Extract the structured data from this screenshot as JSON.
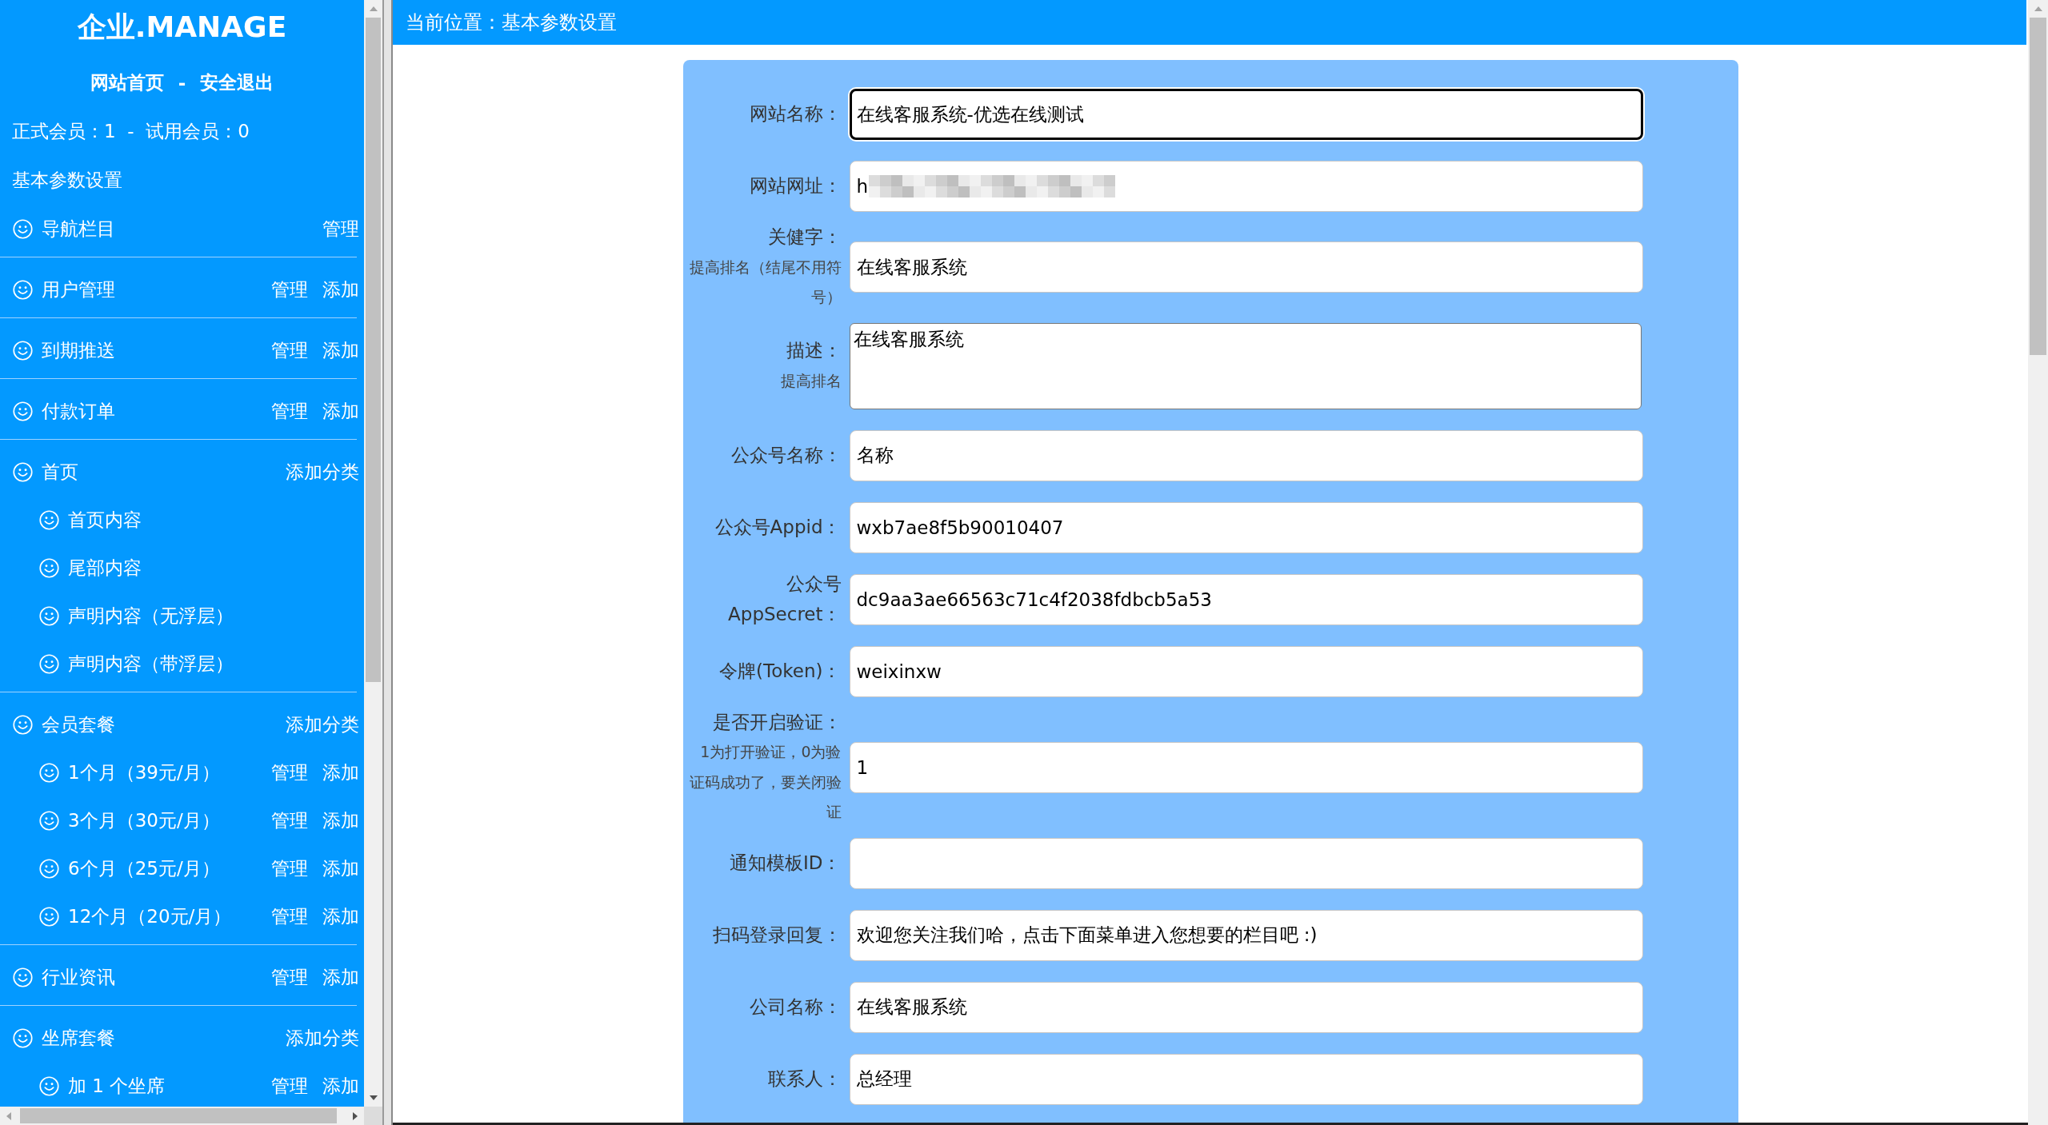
{
  "sidebar": {
    "logo": "企业.MANAGE",
    "top_links": [
      {
        "label": "网站首页"
      },
      {
        "label": "安全退出"
      }
    ],
    "link_separator": "-",
    "member_stats": "正式会员：1  -  试用会员：0",
    "settings_link": "基本参数设置",
    "groups": [
      {
        "label": "导航栏目",
        "actions": [
          "管理"
        ]
      },
      {
        "label": "用户管理",
        "actions": [
          "管理",
          "添加"
        ]
      },
      {
        "label": "到期推送",
        "actions": [
          "管理",
          "添加"
        ]
      },
      {
        "label": "付款订单",
        "actions": [
          "管理",
          "添加"
        ]
      },
      {
        "label": "首页",
        "actions": [
          "添加分类"
        ],
        "children": [
          {
            "label": "首页内容"
          },
          {
            "label": "尾部内容"
          },
          {
            "label": "声明内容（无浮层）"
          },
          {
            "label": "声明内容（带浮层）"
          }
        ]
      },
      {
        "label": "会员套餐",
        "actions": [
          "添加分类"
        ],
        "children": [
          {
            "label": "1个月（39元/月）",
            "actions": [
              "管理",
              "添加"
            ]
          },
          {
            "label": "3个月（30元/月）",
            "actions": [
              "管理",
              "添加"
            ]
          },
          {
            "label": "6个月（25元/月）",
            "actions": [
              "管理",
              "添加"
            ]
          },
          {
            "label": "12个月（20元/月）",
            "actions": [
              "管理",
              "添加"
            ]
          }
        ]
      },
      {
        "label": "行业资讯",
        "actions": [
          "管理",
          "添加"
        ]
      },
      {
        "label": "坐席套餐",
        "actions": [
          "添加分类"
        ],
        "children": [
          {
            "label": "加 1 个坐席",
            "actions": [
              "管理",
              "添加"
            ]
          }
        ]
      }
    ]
  },
  "breadcrumb": "当前位置：基本参数设置",
  "form": {
    "fields": [
      {
        "label": "网站名称：",
        "kind": "input",
        "value": "在线客服系统-优选在线测试",
        "focused": true,
        "redacted": false
      },
      {
        "label": "网站网址：",
        "kind": "input",
        "value": "h",
        "focused": false,
        "redacted": true
      },
      {
        "label": "关健字：",
        "note": "提高排名（结尾不用符号）",
        "kind": "input",
        "value": "在线客服系统",
        "focused": false,
        "redacted": false
      },
      {
        "label": "描述：",
        "note": "提高排名",
        "kind": "textarea",
        "value": "在线客服系统",
        "focused": false,
        "redacted": false
      },
      {
        "label": "公众号名称：",
        "kind": "input",
        "value": "名称",
        "focused": false,
        "redacted": false
      },
      {
        "label": "公众号Appid：",
        "kind": "input",
        "value": "wxb7ae8f5b90010407",
        "focused": false,
        "redacted": false
      },
      {
        "label": "公众号AppSecret：",
        "kind": "input",
        "value": "dc9aa3ae66563c71c4f2038fdbcb5a53",
        "focused": false,
        "redacted": false
      },
      {
        "label": "令牌(Token)：",
        "kind": "input",
        "value": "weixinxw",
        "focused": false,
        "redacted": false
      },
      {
        "label": "是否开启验证：",
        "note": "1为打开验证，0为验证码成功了，要关闭验证",
        "kind": "input",
        "value": "1",
        "focused": false,
        "redacted": false
      },
      {
        "label": "通知模板ID：",
        "kind": "input",
        "focused": false,
        "redacted": false
      },
      {
        "label": "扫码登录回复：",
        "kind": "input",
        "value": "欢迎您关注我们哈，点击下面菜单进入您想要的栏目吧 :)",
        "focused": false,
        "redacted": false
      },
      {
        "label": "公司名称：",
        "kind": "input",
        "value": "在线客服系统",
        "focused": false,
        "redacted": false
      },
      {
        "label": "联系人：",
        "kind": "input",
        "value": "总经理",
        "focused": false,
        "redacted": false
      }
    ]
  }
}
